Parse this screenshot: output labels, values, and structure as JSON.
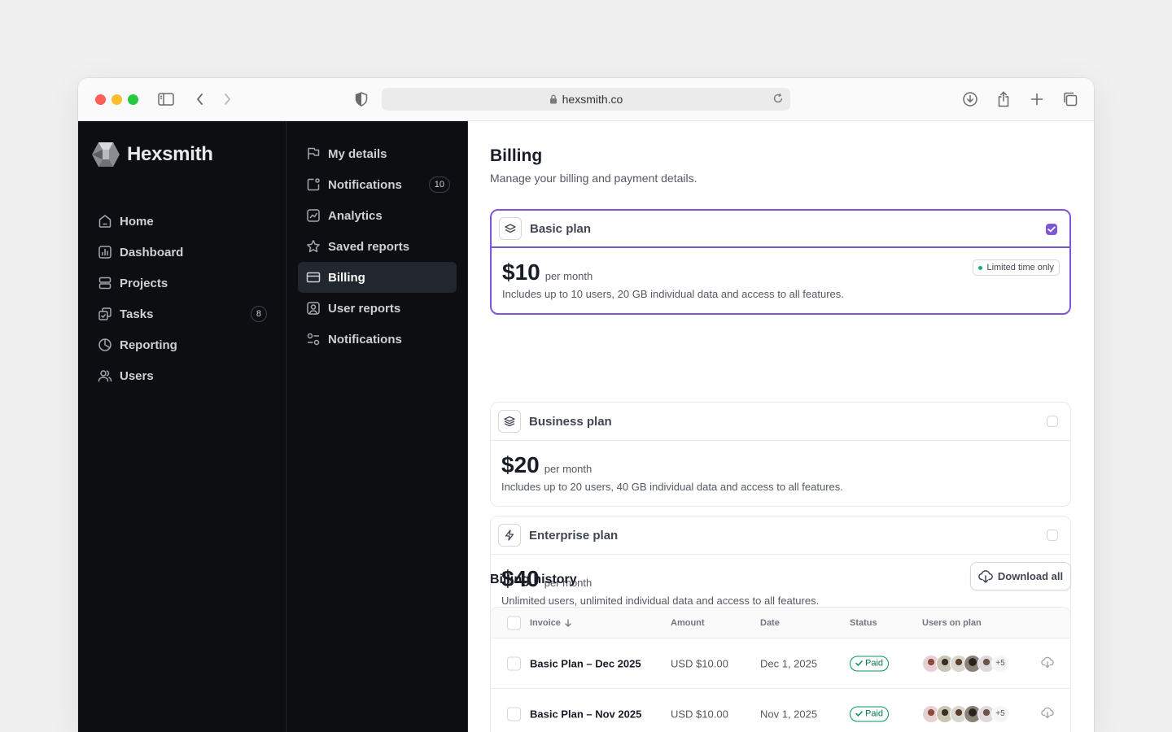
{
  "browser": {
    "url": "hexsmith.co"
  },
  "app": {
    "name": "Hexsmith"
  },
  "primary_nav": [
    {
      "label": "Home",
      "icon": "home-icon"
    },
    {
      "label": "Dashboard",
      "icon": "bar-chart-icon"
    },
    {
      "label": "Projects",
      "icon": "layers-icon"
    },
    {
      "label": "Tasks",
      "icon": "check-done-icon",
      "badge": "8"
    },
    {
      "label": "Reporting",
      "icon": "pie-chart-icon"
    },
    {
      "label": "Users",
      "icon": "users-icon"
    }
  ],
  "settings_nav": [
    {
      "label": "My details",
      "icon": "flag-icon"
    },
    {
      "label": "Notifications",
      "icon": "notification-box-icon",
      "badge": "10"
    },
    {
      "label": "Analytics",
      "icon": "line-chart-icon"
    },
    {
      "label": "Saved reports",
      "icon": "star-icon"
    },
    {
      "label": "Billing",
      "icon": "credit-card-icon",
      "active": true
    },
    {
      "label": "User reports",
      "icon": "user-square-icon"
    },
    {
      "label": "Notifications",
      "icon": "toggle-icon"
    }
  ],
  "page": {
    "title": "Billing",
    "subtitle": "Manage your billing and payment details."
  },
  "plans": [
    {
      "name": "Basic plan",
      "price": "$10",
      "period": "per month",
      "description": "Includes up to 10 users, 20 GB individual data and access to all features.",
      "selected": true,
      "tag": "Limited time only",
      "icon": "layers-two-icon"
    },
    {
      "name": "Business plan",
      "price": "$20",
      "period": "per month",
      "description": "Includes up to 20 users, 40 GB individual data and access to all features.",
      "selected": false,
      "icon": "layers-three-icon"
    },
    {
      "name": "Enterprise plan",
      "price": "$40",
      "period": "per month",
      "description": "Unlimited users, unlimited individual data and access to all features.",
      "selected": false,
      "icon": "zap-icon"
    }
  ],
  "billing_history": {
    "title": "Billing history",
    "download_label": "Download all",
    "columns": [
      "Invoice",
      "Amount",
      "Date",
      "Status",
      "Users on plan"
    ],
    "rows": [
      {
        "invoice": "Basic Plan – Dec 2025",
        "amount": "USD $10.00",
        "date": "Dec 1, 2025",
        "status": "Paid",
        "more_users": "+5"
      },
      {
        "invoice": "Basic Plan – Nov 2025",
        "amount": "USD $10.00",
        "date": "Nov 1, 2025",
        "status": "Paid",
        "more_users": "+5"
      }
    ]
  },
  "colors": {
    "accent": "#7f56d9",
    "sidebar_bg": "#0c0e12",
    "success": "#079455"
  }
}
